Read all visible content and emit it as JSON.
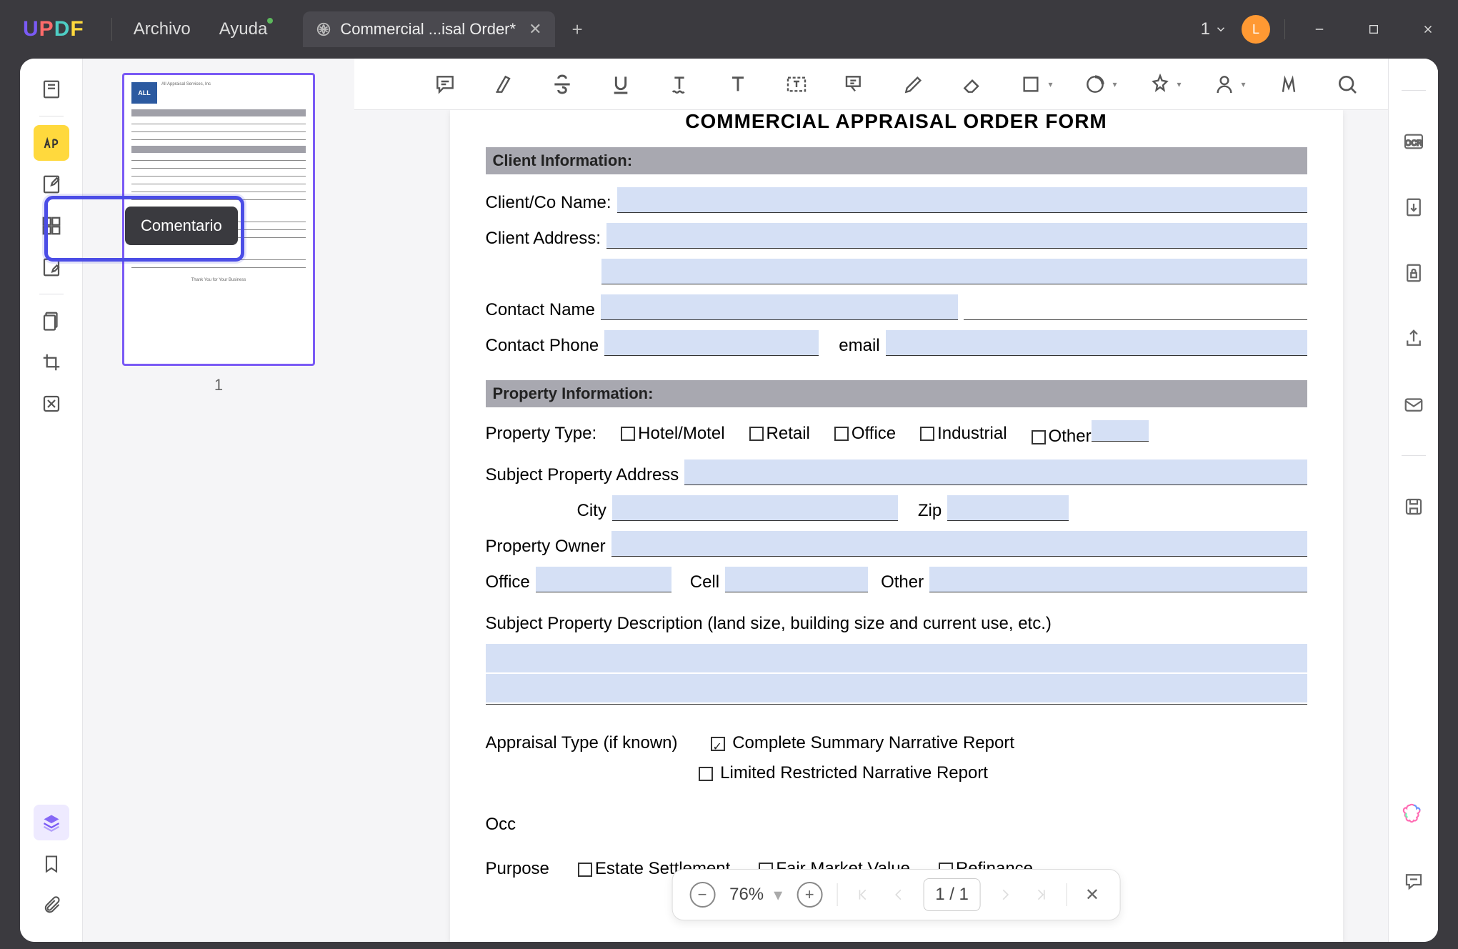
{
  "titlebar": {
    "logo": "UPDF",
    "menu": {
      "file": "Archivo",
      "help": "Ayuda"
    },
    "tab_title": "Commercial ...isal Order*",
    "tab_count": "1",
    "avatar_initial": "L"
  },
  "tooltip": {
    "comment": "Comentario"
  },
  "thumb": {
    "page_num": "1"
  },
  "document": {
    "title": "COMMERCIAL APPRAISAL ORDER FORM",
    "sections": {
      "client": "Client Information:",
      "property": "Property Information:"
    },
    "labels": {
      "client_name": "Client/Co Name:",
      "client_address": "Client Address:",
      "contact_name": "Contact Name",
      "contact_phone": "Contact Phone",
      "email": "email",
      "property_type": "Property Type:",
      "hotel": "Hotel/Motel",
      "retail": "Retail",
      "office_type": "Office",
      "industrial": "Industrial",
      "other_type": "Other",
      "subject_address": "Subject Property Address",
      "city": "City",
      "zip": "Zip",
      "property_owner": "Property Owner",
      "office": "Office",
      "cell": "Cell",
      "other": "Other",
      "description": "Subject Property Description (land size, building size and current use, etc.)",
      "appraisal_type": "Appraisal Type (if known)",
      "complete_summary": "Complete Summary Narrative Report",
      "limited": "Limited Restricted Narrative Report",
      "occ": "Occ",
      "purpose": "Purpose",
      "estate": "Estate Settlement",
      "fmv": "Fair Market Value",
      "refinance": "Refinance"
    }
  },
  "bottom": {
    "zoom": "76%",
    "page": "1  /  1"
  },
  "right_rail": {
    "ocr": "OCR"
  }
}
